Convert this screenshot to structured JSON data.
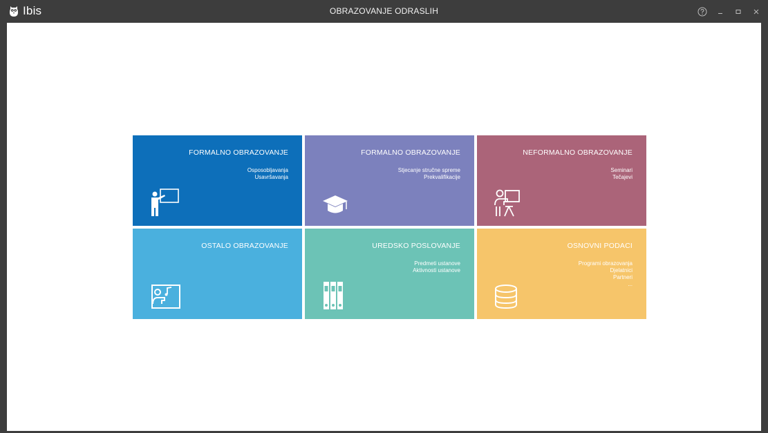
{
  "app": {
    "name": "Ibis",
    "window_title": "OBRAZOVANJE ODRASLIH",
    "icons": {
      "logo": "owl-logo-icon",
      "help": "help-icon",
      "minimize": "minimize-icon",
      "maximize": "maximize-icon",
      "close": "close-icon"
    }
  },
  "tiles": [
    {
      "title": "FORMALNO OBRAZOVANJE",
      "items": [
        "Osposobljavanja",
        "Usavršavanja"
      ],
      "color": "#0d6fba",
      "icon": "teacher-board-icon"
    },
    {
      "title": "FORMALNO OBRAZOVANJE",
      "items": [
        "Stjecanje stručne spreme",
        "Prekvalifikacije"
      ],
      "color": "#7c81bd",
      "icon": "graduation-cap-icon"
    },
    {
      "title": "NEFORMALNO OBRAZOVANJE",
      "items": [
        "Seminari",
        "Tečajevi"
      ],
      "color": "#ab6479",
      "icon": "presenter-icon"
    },
    {
      "title": "OSTALO OBRAZOVANJE",
      "items": [],
      "color": "#4ab0de",
      "icon": "music-class-icon"
    },
    {
      "title": "UREDSKO POSLOVANJE",
      "items": [
        "Predmeti ustanove",
        "Aktivnosti ustanove"
      ],
      "color": "#6cc3b6",
      "icon": "binders-icon"
    },
    {
      "title": "OSNOVNI PODACI",
      "items": [
        "Programi obrazovanja",
        "Djelatnici",
        "Partneri",
        "..."
      ],
      "color": "#f6c56a",
      "icon": "database-icon"
    }
  ]
}
